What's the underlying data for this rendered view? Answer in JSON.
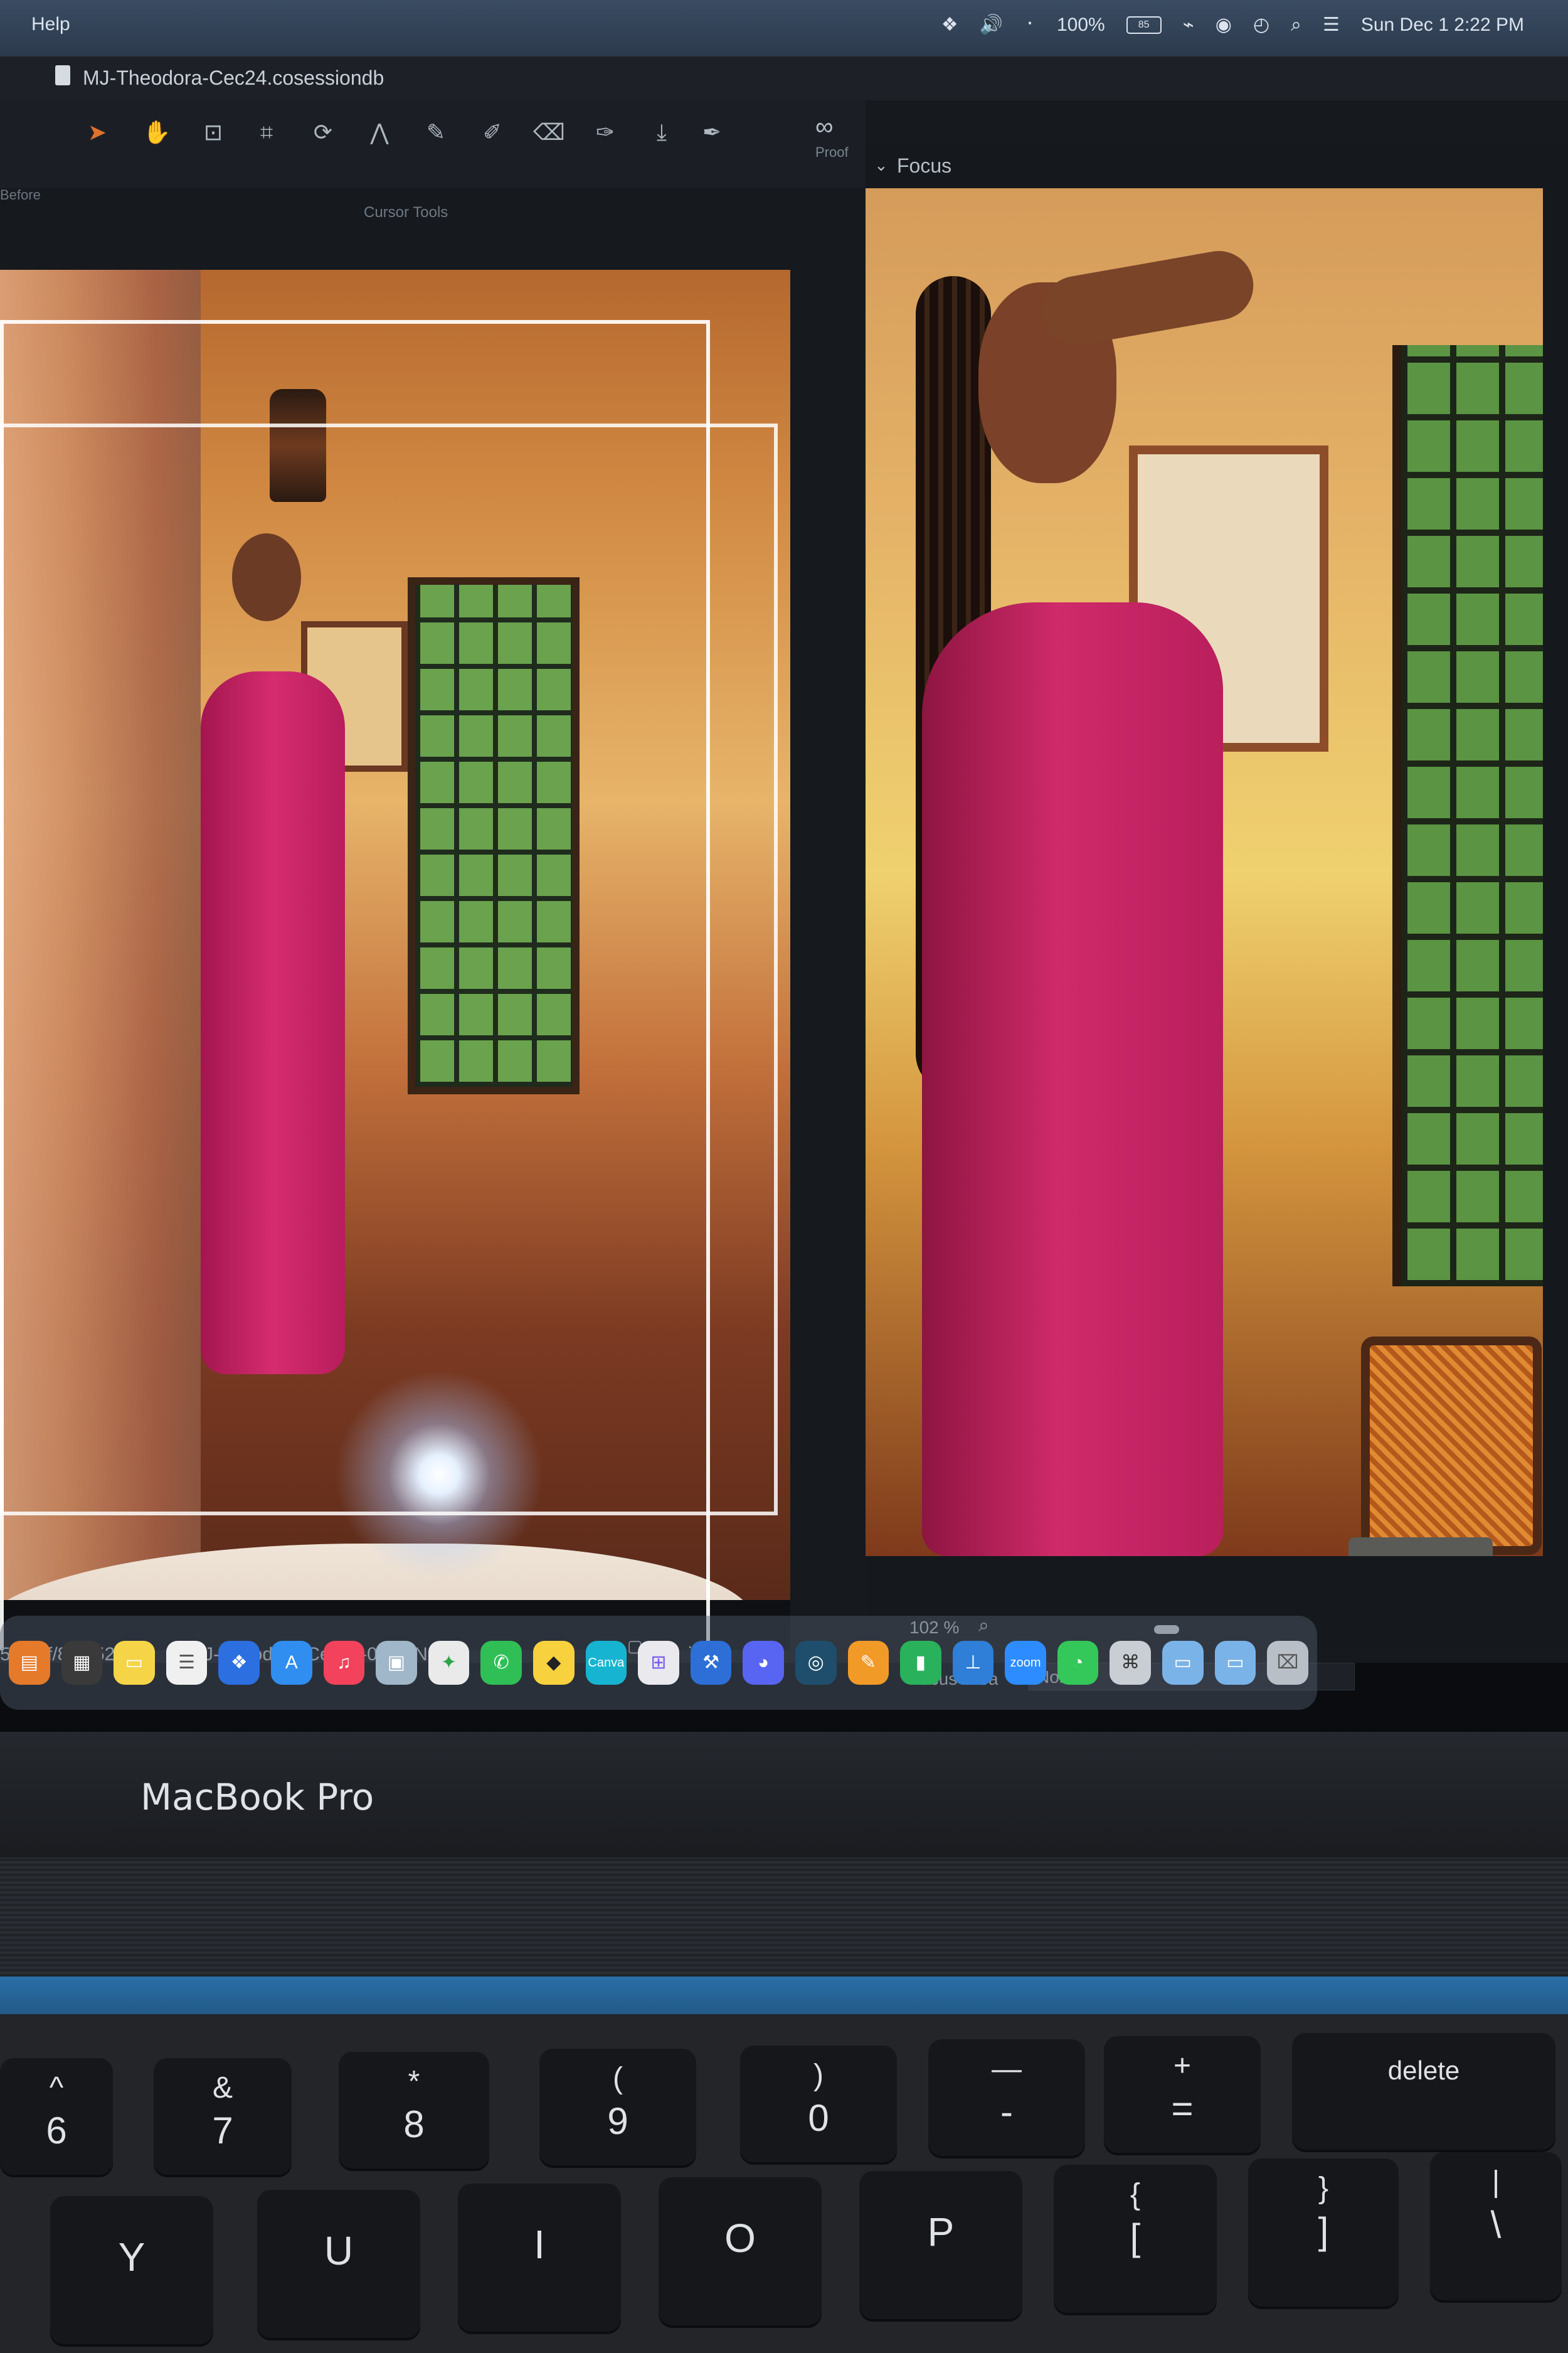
{
  "menubar": {
    "left_label": "Help",
    "battery": "100%",
    "battery_badge": "85",
    "clock": "Sun Dec 1  2:22 PM"
  },
  "window": {
    "title": "MJ-Theodora-Cec24.cosessiondb",
    "before_label": "Before",
    "cursor_tools_label": "Cursor Tools",
    "proof_label": "Proof"
  },
  "focus_panel": {
    "header": "Focus",
    "zoom": "102 %",
    "focus_area_label": "Focus Area",
    "focus_area_value": "None"
  },
  "info_bar": {
    "shutter": "5 s",
    "aperture": "f/8",
    "focal_length": "52 mm",
    "filename": "MJ-Theodora-Cec24-0487.NEF"
  },
  "dock": {
    "apps": [
      "books",
      "calculator",
      "notes",
      "reminders",
      "dropbox",
      "app-store",
      "music",
      "preview",
      "evernote",
      "whatsapp",
      "notes-yellow",
      "canva",
      "launchpad",
      "xcode",
      "discord",
      "focus",
      "pages",
      "numbers",
      "keynote",
      "zoom",
      "messages",
      "screenshot",
      "folders",
      "trash"
    ],
    "labels": {
      "canva": "Canva",
      "zoom": "zoom"
    }
  },
  "laptop": {
    "brand": "MacBook Pro"
  },
  "keyboard": {
    "row1": [
      {
        "top": "^",
        "bot": "6"
      },
      {
        "top": "&",
        "bot": "7"
      },
      {
        "top": "*",
        "bot": "8"
      },
      {
        "top": "(",
        "bot": "9"
      },
      {
        "top": ")",
        "bot": "0"
      },
      {
        "top": "—",
        "bot": "-"
      },
      {
        "top": "+",
        "bot": "="
      },
      {
        "word": "delete"
      }
    ],
    "row2": [
      {
        "single": "Y"
      },
      {
        "single": "U"
      },
      {
        "single": "I"
      },
      {
        "single": "O"
      },
      {
        "single": "P"
      },
      {
        "top": "{",
        "bot": "["
      },
      {
        "top": "}",
        "bot": "]"
      },
      {
        "top": "|",
        "bot": "\\"
      }
    ]
  }
}
